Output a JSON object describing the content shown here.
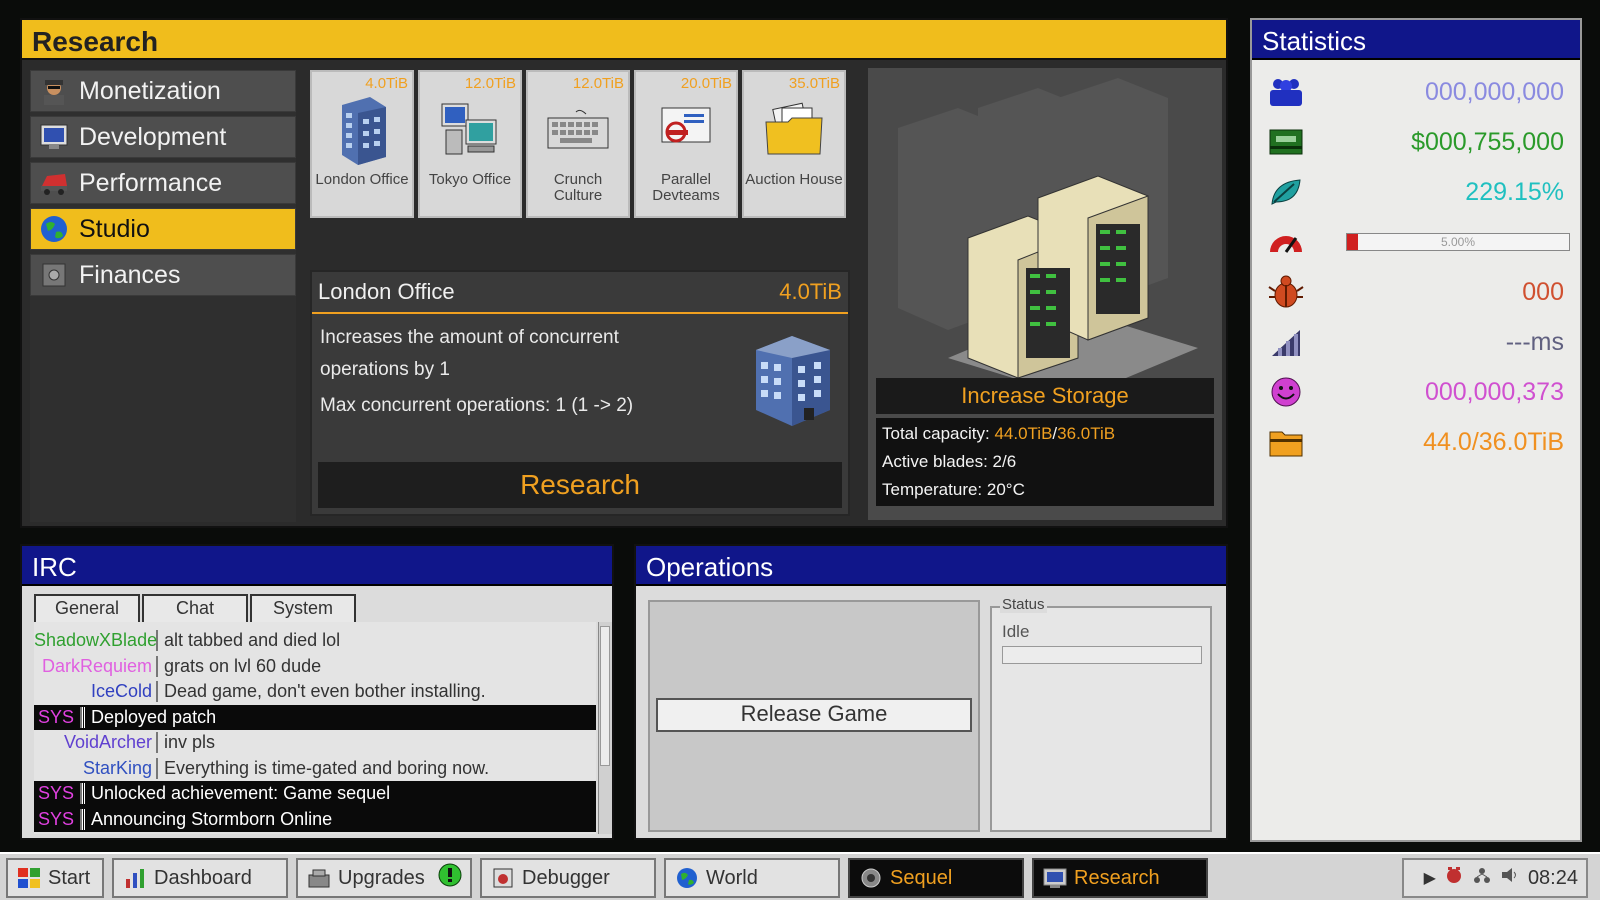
{
  "research": {
    "title": "Research",
    "categories": [
      {
        "label": "Monetization",
        "icon": "spy-icon"
      },
      {
        "label": "Development",
        "icon": "monitor-icon"
      },
      {
        "label": "Performance",
        "icon": "racecar-icon"
      },
      {
        "label": "Studio",
        "icon": "globe-icon",
        "active": true
      },
      {
        "label": "Finances",
        "icon": "safe-icon"
      }
    ],
    "cards": [
      {
        "label": "London Office",
        "cost": "4.0TiB",
        "icon": "office-building-icon"
      },
      {
        "label": "Tokyo Office",
        "cost": "12.0TiB",
        "icon": "workstation-icon"
      },
      {
        "label": "Crunch Culture",
        "cost": "12.0TiB",
        "icon": "keyboard-icon"
      },
      {
        "label": "Parallel Devteams",
        "cost": "20.0TiB",
        "icon": "letter-icon"
      },
      {
        "label": "Auction House",
        "cost": "35.0TiB",
        "icon": "folder-icon"
      }
    ],
    "detail": {
      "title": "London Office",
      "cost": "4.0TiB",
      "desc1": "Increases the amount of concurrent",
      "desc2": "operations by 1",
      "desc3": "Max concurrent operations: 1 (1 -> 2)",
      "button": "Research"
    },
    "storage": {
      "button": "Increase Storage",
      "capacity_label": "Total capacity: ",
      "capacity_used": "44.0TiB",
      "capacity_sep": "/",
      "capacity_total": "36.0TiB",
      "blades": "Active blades: 2/6",
      "temperature": "Temperature: 20°C"
    }
  },
  "statistics": {
    "title": "Statistics",
    "rows": [
      {
        "icon": "users-icon",
        "value": "000,000,000",
        "color": "#8a8ae0"
      },
      {
        "icon": "cash-icon",
        "value": "$000,755,000",
        "color": "#2a9a2a"
      },
      {
        "icon": "leaf-icon",
        "value": "229.15%",
        "color": "#20c0c0"
      },
      {
        "icon": "gauge-icon",
        "value": "5.00%",
        "color": "#d02020",
        "progress": 0.05
      },
      {
        "icon": "bug-icon",
        "value": "000",
        "color": "#d05030"
      },
      {
        "icon": "signal-icon",
        "value": "---ms",
        "color": "#606080"
      },
      {
        "icon": "smiley-icon",
        "value": "000,000,373",
        "color": "#d050d0"
      },
      {
        "icon": "storage-folder-icon",
        "value": "44.0/36.0TiB",
        "color": "#f09020"
      }
    ]
  },
  "irc": {
    "title": "IRC",
    "tabs": [
      "General",
      "Chat",
      "System"
    ],
    "messages": [
      {
        "nick": "ShadowXBlade",
        "text": "alt tabbed and died lol",
        "color": "#30a030"
      },
      {
        "nick": "DarkRequiem",
        "text": "grats on lvl 60 dude",
        "color": "#e060e0"
      },
      {
        "nick": "IceCold",
        "text": "Dead game, don't even bother installing.",
        "color": "#3040c0"
      },
      {
        "nick": "SYS",
        "text": "Deployed patch",
        "sys": true
      },
      {
        "nick": "VoidArcher",
        "text": "inv pls",
        "color": "#6040d0"
      },
      {
        "nick": "StarKing",
        "text": "Everything is time-gated and boring now.",
        "color": "#3050c0"
      },
      {
        "nick": "SYS",
        "text": "Unlocked achievement: Game sequel",
        "sys": true
      },
      {
        "nick": "SYS",
        "text": "Announcing Stormborn Online",
        "sys": true
      }
    ]
  },
  "operations": {
    "title": "Operations",
    "button": "Release Game",
    "status_legend": "Status",
    "status_value": "Idle"
  },
  "taskbar": {
    "start": "Start",
    "items": [
      "Dashboard",
      "Upgrades",
      "Debugger",
      "World",
      "Sequel",
      "Research"
    ],
    "clock": "08:24"
  }
}
